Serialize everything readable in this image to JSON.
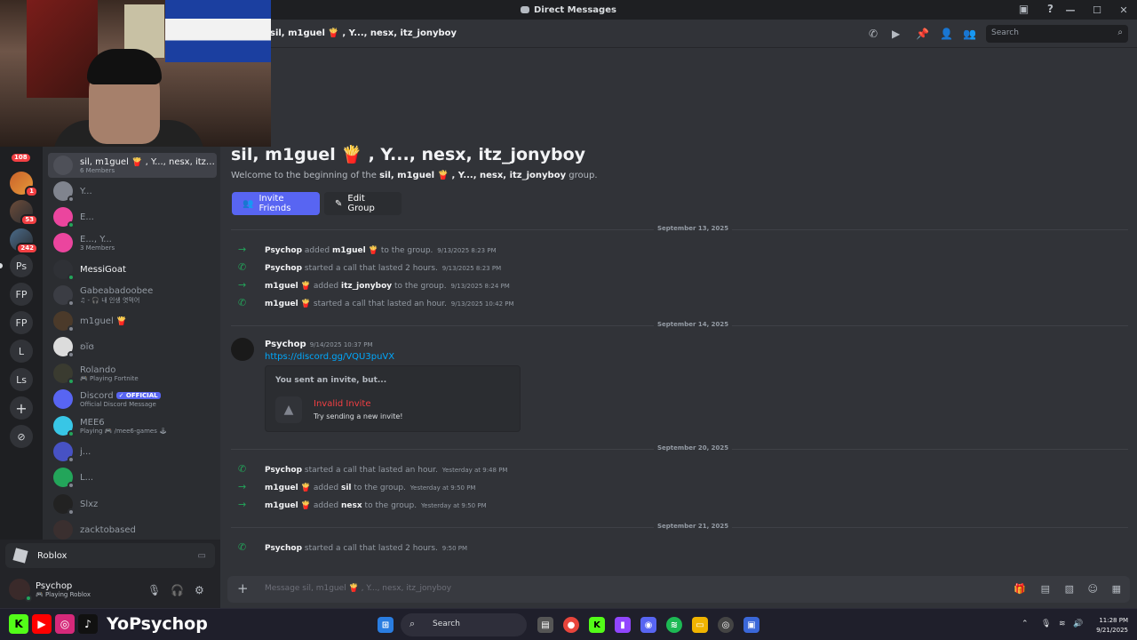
{
  "window": {
    "title": "Direct Messages"
  },
  "rail": {
    "badge_top": "108",
    "servers": [
      {
        "label": "",
        "badge": "1"
      },
      {
        "label": "",
        "badge": "53"
      },
      {
        "label": "",
        "badge": "242"
      },
      {
        "label": "Ps"
      },
      {
        "label": "FP"
      },
      {
        "label": "FP"
      },
      {
        "label": "L"
      },
      {
        "label": "Ls"
      }
    ],
    "add_label": "+",
    "discover_label": "⊘"
  },
  "dms": [
    {
      "name": "sil, m1guel 🍟 , Y..., nesx, itz_jo...",
      "sub": "6 Members"
    },
    {
      "name": "Y...",
      "sub": ""
    },
    {
      "name": "E...",
      "sub": ""
    },
    {
      "name": "E..., Y...",
      "sub": "3 Members"
    },
    {
      "name": "MessiGoat",
      "sub": ""
    },
    {
      "name": "Gabeabadoobee",
      "sub": "♫ - 🎧 내 인생 엿먹어"
    },
    {
      "name": "m1guel 🍟",
      "sub": ""
    },
    {
      "name": "ʚĭɞ",
      "sub": ""
    },
    {
      "name": "Rolando",
      "sub": "🎮 Playing Fortnite"
    },
    {
      "name": "Discord",
      "sub": "Official Discord Message",
      "tag": "✓ OFFICIAL"
    },
    {
      "name": "MEE6",
      "sub": "Playing 🎮 /mee6-games 🕹"
    },
    {
      "name": "j...",
      "sub": ""
    },
    {
      "name": "L...",
      "sub": ""
    },
    {
      "name": "Slxz",
      "sub": ""
    },
    {
      "name": "zacktobased",
      "sub": ""
    }
  ],
  "activity": {
    "game": "Roblox"
  },
  "user": {
    "name": "Psychop",
    "status": "🎮 Playing Roblox"
  },
  "header": {
    "title": "sil, m1guel 🍟 , Y..., nesx, itz_jonyboy",
    "search_placeholder": "Search"
  },
  "intro": {
    "title": "sil, m1guel 🍟 , Y..., nesx, itz_jonyboy",
    "welcome_pre": "Welcome to the beginning of the ",
    "welcome_group": "sil, m1guel 🍟 , Y..., nesx, itz_jonyboy",
    "welcome_post": " group.",
    "invite_button": "Invite Friends",
    "edit_button": "Edit Group"
  },
  "dividers": [
    "September 13, 2025",
    "September 14, 2025",
    "September 20, 2025",
    "September 21, 2025"
  ],
  "events": [
    {
      "actor": "Psychop",
      "verb": "added",
      "target": "m1guel 🍟",
      "suffix": "to the group.",
      "time": "9/13/2025 8:23 PM",
      "kind": "join"
    },
    {
      "actor": "Psychop",
      "verb": "started a call that lasted 2 hours.",
      "target": "",
      "suffix": "",
      "time": "9/13/2025 8:23 PM",
      "kind": "call"
    },
    {
      "actor": "m1guel 🍟",
      "verb": "added",
      "target": "itz_jonyboy",
      "suffix": "to the group.",
      "time": "9/13/2025 8:24 PM",
      "kind": "join"
    },
    {
      "actor": "m1guel 🍟",
      "verb": "started a call that lasted an hour.",
      "target": "",
      "suffix": "",
      "time": "9/13/2025 10:42 PM",
      "kind": "call"
    },
    {
      "actor": "Psychop",
      "verb": "started a call that lasted an hour.",
      "target": "",
      "suffix": "",
      "time": "Yesterday at 9:48 PM",
      "kind": "call"
    },
    {
      "actor": "m1guel 🍟",
      "verb": "added",
      "target": "sil",
      "suffix": "to the group.",
      "time": "Yesterday at 9:50 PM",
      "kind": "join"
    },
    {
      "actor": "m1guel 🍟",
      "verb": "added",
      "target": "nesx",
      "suffix": "to the group.",
      "time": "Yesterday at 9:50 PM",
      "kind": "join"
    },
    {
      "actor": "Psychop",
      "verb": "started a call that lasted 2 hours.",
      "target": "",
      "suffix": "",
      "time": "9:50 PM",
      "kind": "call"
    }
  ],
  "message": {
    "author": "Psychop",
    "time": "9/14/2025 10:37 PM",
    "link": "https://discord.gg/VQU3puVX",
    "invite_header": "You sent an invite, but...",
    "invite_status": "Invalid Invite",
    "invite_hint": "Try sending a new invite!"
  },
  "composer": {
    "placeholder": "Message sil, m1guel 🍟 , Y..., nesx, itz_jonyboy"
  },
  "taskbar": {
    "search": "Search",
    "time": "11:28 PM",
    "date": "9/21/2025"
  },
  "overlay": {
    "handle": "YoPsychop"
  },
  "colors": {
    "accent": "#5865f2",
    "online": "#23a55a",
    "danger": "#f23f43",
    "link": "#00a8fc"
  }
}
